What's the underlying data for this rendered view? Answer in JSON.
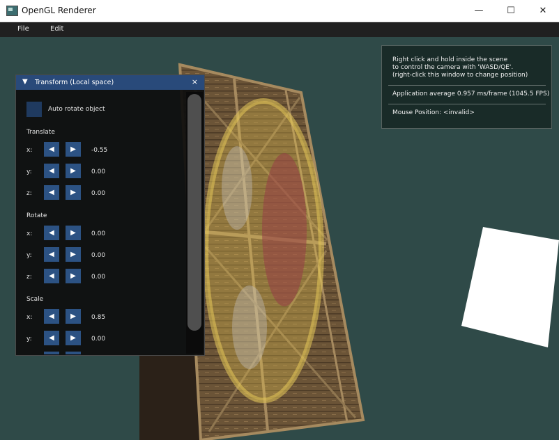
{
  "window": {
    "title": "OpenGL Renderer",
    "minimize": "—",
    "maximize": "☐",
    "close": "✕"
  },
  "menu": {
    "file": "File",
    "edit": "Edit"
  },
  "panel": {
    "title": "Transform (Local space)",
    "collapse_arrow": "▼",
    "close": "×",
    "auto_rotate_label": "Auto rotate object",
    "auto_rotate_checked": false,
    "left_arrow": "◀",
    "right_arrow": "▶",
    "translate": {
      "label": "Translate",
      "x_label": "x:",
      "x": "-0.55",
      "y_label": "y:",
      "y": "0.00",
      "z_label": "z:",
      "z": "0.00"
    },
    "rotate": {
      "label": "Rotate",
      "x_label": "x:",
      "x": "0.00",
      "y_label": "y:",
      "y": "0.00",
      "z_label": "z:",
      "z": "0.00"
    },
    "scale": {
      "label": "Scale",
      "x_label": "x:",
      "x": "0.85",
      "y_label": "y:",
      "y": "0.00"
    }
  },
  "overlay": {
    "line1": "Right click and hold inside the scene",
    "line2": "to control the camera with 'WASD/QE'.",
    "line3": "(right-click this window to change position)",
    "fps": "Application average 0.957 ms/frame (1045.5 FPS)",
    "mouse": "Mouse Position: <invalid>"
  },
  "colors": {
    "scene_bg": "#2f4a48",
    "header_blue": "#294a7a",
    "button_blue": "#2c5283"
  }
}
